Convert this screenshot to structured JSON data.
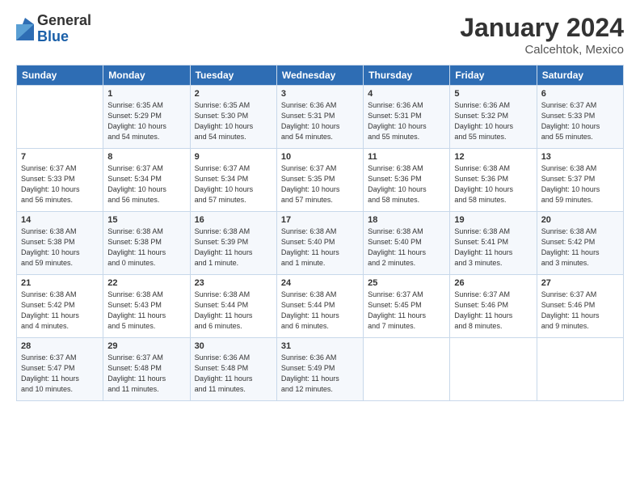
{
  "logo": {
    "general": "General",
    "blue": "Blue"
  },
  "header": {
    "month": "January 2024",
    "location": "Calcehtok, Mexico"
  },
  "days_of_week": [
    "Sunday",
    "Monday",
    "Tuesday",
    "Wednesday",
    "Thursday",
    "Friday",
    "Saturday"
  ],
  "weeks": [
    [
      {
        "day": "",
        "info": ""
      },
      {
        "day": "1",
        "info": "Sunrise: 6:35 AM\nSunset: 5:29 PM\nDaylight: 10 hours\nand 54 minutes."
      },
      {
        "day": "2",
        "info": "Sunrise: 6:35 AM\nSunset: 5:30 PM\nDaylight: 10 hours\nand 54 minutes."
      },
      {
        "day": "3",
        "info": "Sunrise: 6:36 AM\nSunset: 5:31 PM\nDaylight: 10 hours\nand 54 minutes."
      },
      {
        "day": "4",
        "info": "Sunrise: 6:36 AM\nSunset: 5:31 PM\nDaylight: 10 hours\nand 55 minutes."
      },
      {
        "day": "5",
        "info": "Sunrise: 6:36 AM\nSunset: 5:32 PM\nDaylight: 10 hours\nand 55 minutes."
      },
      {
        "day": "6",
        "info": "Sunrise: 6:37 AM\nSunset: 5:33 PM\nDaylight: 10 hours\nand 55 minutes."
      }
    ],
    [
      {
        "day": "7",
        "info": "Sunrise: 6:37 AM\nSunset: 5:33 PM\nDaylight: 10 hours\nand 56 minutes."
      },
      {
        "day": "8",
        "info": "Sunrise: 6:37 AM\nSunset: 5:34 PM\nDaylight: 10 hours\nand 56 minutes."
      },
      {
        "day": "9",
        "info": "Sunrise: 6:37 AM\nSunset: 5:34 PM\nDaylight: 10 hours\nand 57 minutes."
      },
      {
        "day": "10",
        "info": "Sunrise: 6:37 AM\nSunset: 5:35 PM\nDaylight: 10 hours\nand 57 minutes."
      },
      {
        "day": "11",
        "info": "Sunrise: 6:38 AM\nSunset: 5:36 PM\nDaylight: 10 hours\nand 58 minutes."
      },
      {
        "day": "12",
        "info": "Sunrise: 6:38 AM\nSunset: 5:36 PM\nDaylight: 10 hours\nand 58 minutes."
      },
      {
        "day": "13",
        "info": "Sunrise: 6:38 AM\nSunset: 5:37 PM\nDaylight: 10 hours\nand 59 minutes."
      }
    ],
    [
      {
        "day": "14",
        "info": "Sunrise: 6:38 AM\nSunset: 5:38 PM\nDaylight: 10 hours\nand 59 minutes."
      },
      {
        "day": "15",
        "info": "Sunrise: 6:38 AM\nSunset: 5:38 PM\nDaylight: 11 hours\nand 0 minutes."
      },
      {
        "day": "16",
        "info": "Sunrise: 6:38 AM\nSunset: 5:39 PM\nDaylight: 11 hours\nand 1 minute."
      },
      {
        "day": "17",
        "info": "Sunrise: 6:38 AM\nSunset: 5:40 PM\nDaylight: 11 hours\nand 1 minute."
      },
      {
        "day": "18",
        "info": "Sunrise: 6:38 AM\nSunset: 5:40 PM\nDaylight: 11 hours\nand 2 minutes."
      },
      {
        "day": "19",
        "info": "Sunrise: 6:38 AM\nSunset: 5:41 PM\nDaylight: 11 hours\nand 3 minutes."
      },
      {
        "day": "20",
        "info": "Sunrise: 6:38 AM\nSunset: 5:42 PM\nDaylight: 11 hours\nand 3 minutes."
      }
    ],
    [
      {
        "day": "21",
        "info": "Sunrise: 6:38 AM\nSunset: 5:42 PM\nDaylight: 11 hours\nand 4 minutes."
      },
      {
        "day": "22",
        "info": "Sunrise: 6:38 AM\nSunset: 5:43 PM\nDaylight: 11 hours\nand 5 minutes."
      },
      {
        "day": "23",
        "info": "Sunrise: 6:38 AM\nSunset: 5:44 PM\nDaylight: 11 hours\nand 6 minutes."
      },
      {
        "day": "24",
        "info": "Sunrise: 6:38 AM\nSunset: 5:44 PM\nDaylight: 11 hours\nand 6 minutes."
      },
      {
        "day": "25",
        "info": "Sunrise: 6:37 AM\nSunset: 5:45 PM\nDaylight: 11 hours\nand 7 minutes."
      },
      {
        "day": "26",
        "info": "Sunrise: 6:37 AM\nSunset: 5:46 PM\nDaylight: 11 hours\nand 8 minutes."
      },
      {
        "day": "27",
        "info": "Sunrise: 6:37 AM\nSunset: 5:46 PM\nDaylight: 11 hours\nand 9 minutes."
      }
    ],
    [
      {
        "day": "28",
        "info": "Sunrise: 6:37 AM\nSunset: 5:47 PM\nDaylight: 11 hours\nand 10 minutes."
      },
      {
        "day": "29",
        "info": "Sunrise: 6:37 AM\nSunset: 5:48 PM\nDaylight: 11 hours\nand 11 minutes."
      },
      {
        "day": "30",
        "info": "Sunrise: 6:36 AM\nSunset: 5:48 PM\nDaylight: 11 hours\nand 11 minutes."
      },
      {
        "day": "31",
        "info": "Sunrise: 6:36 AM\nSunset: 5:49 PM\nDaylight: 11 hours\nand 12 minutes."
      },
      {
        "day": "",
        "info": ""
      },
      {
        "day": "",
        "info": ""
      },
      {
        "day": "",
        "info": ""
      }
    ]
  ]
}
